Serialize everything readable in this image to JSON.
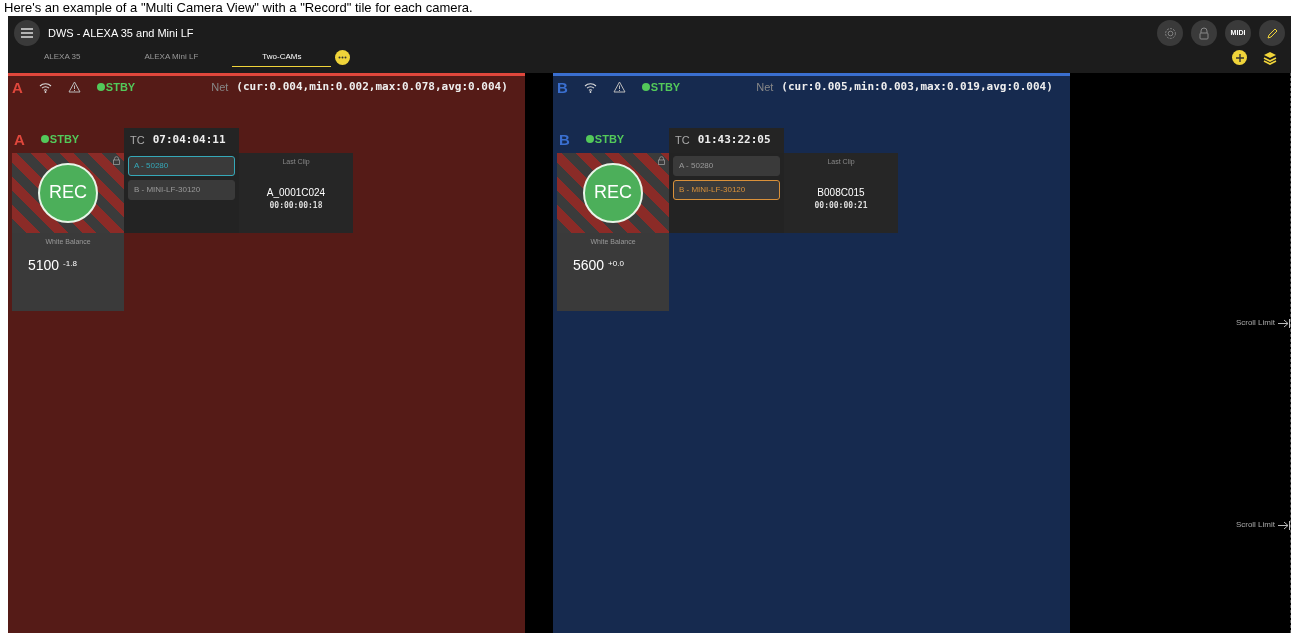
{
  "caption": "Here's an example of a \"Multi Camera View\" with a \"Record\" tile for each camera.",
  "header": {
    "title": "DWS - ALEXA 35 and Mini LF"
  },
  "tabs": [
    {
      "label": "ALEXA 35",
      "selected": false
    },
    {
      "label": "ALEXA Mini LF",
      "selected": false
    },
    {
      "label": "Two-CAMs",
      "selected": true
    }
  ],
  "toolbar": {
    "midi_label": "MIDI"
  },
  "panels": [
    {
      "letter": "A",
      "color": "#e0473c",
      "status": "STBY",
      "net_label": "Net",
      "net_values": "(cur:0.004,min:0.002,max:0.078,avg:0.004)",
      "camera_letter": "A",
      "camera_status": "STBY",
      "tc_label": "TC",
      "timecode": "07:04:04:11",
      "rec_label": "REC",
      "cameras": [
        {
          "label": "A - 50280",
          "selected": true,
          "color": "#35a8b8"
        },
        {
          "label": "B - MINI-LF-30120",
          "selected": false
        }
      ],
      "last_clip": {
        "title": "Last Clip",
        "name": "A_0001C024",
        "duration": "00:00:00:18"
      },
      "white_balance": {
        "title": "White Balance",
        "value": "5100 $^{-1.8}$"
      }
    },
    {
      "letter": "B",
      "color": "#3a6fd0",
      "status": "STBY",
      "net_label": "Net",
      "net_values": "(cur:0.005,min:0.003,max:0.019,avg:0.004)",
      "camera_letter": "B",
      "camera_status": "STBY",
      "tc_label": "TC",
      "timecode": "01:43:22:05",
      "rec_label": "REC",
      "cameras": [
        {
          "label": "A - 50280",
          "selected": false
        },
        {
          "label": "B - MINI-LF-30120",
          "selected": true,
          "color": "#d9913a"
        }
      ],
      "last_clip": {
        "title": "Last Clip",
        "name": "B008C015",
        "duration": "00:00:00:21"
      },
      "white_balance": {
        "title": "White Balance",
        "value": "5600 $^{+0.0}$"
      }
    }
  ],
  "scroll_limits": [
    "Scroll Limit",
    "Scroll Limit"
  ]
}
